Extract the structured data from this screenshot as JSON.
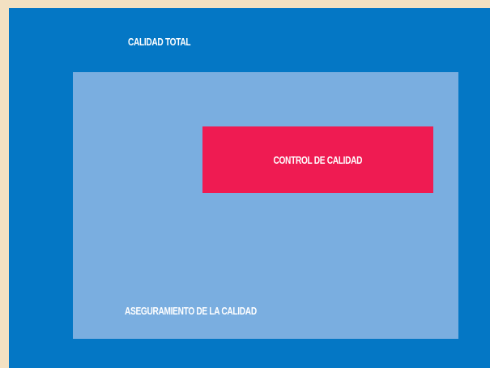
{
  "diagram": {
    "outer_label": "CALIDAD TOTAL",
    "middle_label": "ASEGURAMIENTO DE LA CALIDAD",
    "inner_label": "CONTROL DE CALIDAD"
  },
  "colors": {
    "background": "#f3e1c2",
    "outer": "#0477c5",
    "middle": "#7aaee0",
    "inner": "#ef1b52",
    "text": "#ffffff"
  }
}
